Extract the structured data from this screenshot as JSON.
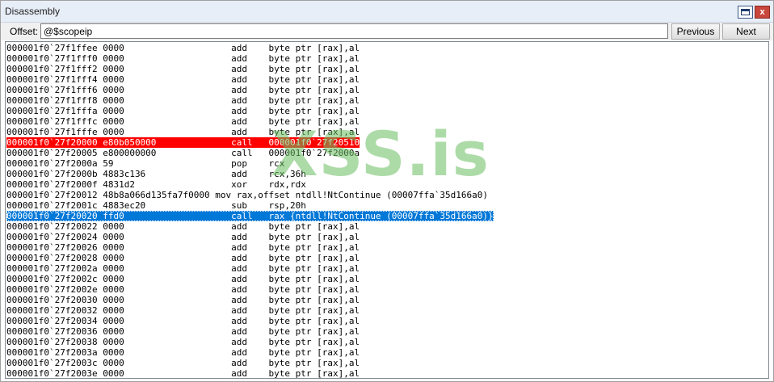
{
  "window": {
    "title": "Disassembly",
    "close_glyph": "x",
    "restore_icon": "window-restore-icon",
    "close_icon": "close-icon"
  },
  "toolbar": {
    "offset_label": "Offset:",
    "offset_value": "@$scopeip",
    "previous_label": "Previous",
    "next_label": "Next"
  },
  "listing": {
    "rows": [
      {
        "addr": "000001f0`27f1ffee",
        "bytes": "0000",
        "mnem": "add",
        "ops": "byte ptr [rax],al"
      },
      {
        "addr": "000001f0`27f1fff0",
        "bytes": "0000",
        "mnem": "add",
        "ops": "byte ptr [rax],al"
      },
      {
        "addr": "000001f0`27f1fff2",
        "bytes": "0000",
        "mnem": "add",
        "ops": "byte ptr [rax],al"
      },
      {
        "addr": "000001f0`27f1fff4",
        "bytes": "0000",
        "mnem": "add",
        "ops": "byte ptr [rax],al"
      },
      {
        "addr": "000001f0`27f1fff6",
        "bytes": "0000",
        "mnem": "add",
        "ops": "byte ptr [rax],al"
      },
      {
        "addr": "000001f0`27f1fff8",
        "bytes": "0000",
        "mnem": "add",
        "ops": "byte ptr [rax],al"
      },
      {
        "addr": "000001f0`27f1fffa",
        "bytes": "0000",
        "mnem": "add",
        "ops": "byte ptr [rax],al"
      },
      {
        "addr": "000001f0`27f1fffc",
        "bytes": "0000",
        "mnem": "add",
        "ops": "byte ptr [rax],al"
      },
      {
        "addr": "000001f0`27f1fffe",
        "bytes": "0000",
        "mnem": "add",
        "ops": "byte ptr [rax],al"
      },
      {
        "addr": "000001f0`27f20000",
        "bytes": "e80b050000",
        "mnem": "call",
        "ops": "000001f0`27f20510",
        "highlight": "red"
      },
      {
        "addr": "000001f0`27f20005",
        "bytes": "e800000000",
        "mnem": "call",
        "ops": "000001f0`27f2000a"
      },
      {
        "addr": "000001f0`27f2000a",
        "bytes": "59",
        "mnem": "pop",
        "ops": "rcx"
      },
      {
        "addr": "000001f0`27f2000b",
        "bytes": "4883c136",
        "mnem": "add",
        "ops": "rcx,36h"
      },
      {
        "addr": "000001f0`27f2000f",
        "bytes": "4831d2",
        "mnem": "xor",
        "ops": "rdx,rdx"
      },
      {
        "addr": "000001f0`27f20012",
        "bytes": "48b8a066d135fa7f0000",
        "mnem": "mov",
        "ops": "rax,offset ntdll!NtContinue (00007ffa`35d166a0)",
        "compact": true
      },
      {
        "addr": "000001f0`27f2001c",
        "bytes": "4883ec20",
        "mnem": "sub",
        "ops": "rsp,20h"
      },
      {
        "addr": "000001f0`27f20020",
        "bytes": "ffd0",
        "mnem": "call",
        "ops": "rax {ntdll!NtContinue (00007ffa`35d166a0)}",
        "highlight": "blue"
      },
      {
        "addr": "000001f0`27f20022",
        "bytes": "0000",
        "mnem": "add",
        "ops": "byte ptr [rax],al"
      },
      {
        "addr": "000001f0`27f20024",
        "bytes": "0000",
        "mnem": "add",
        "ops": "byte ptr [rax],al"
      },
      {
        "addr": "000001f0`27f20026",
        "bytes": "0000",
        "mnem": "add",
        "ops": "byte ptr [rax],al"
      },
      {
        "addr": "000001f0`27f20028",
        "bytes": "0000",
        "mnem": "add",
        "ops": "byte ptr [rax],al"
      },
      {
        "addr": "000001f0`27f2002a",
        "bytes": "0000",
        "mnem": "add",
        "ops": "byte ptr [rax],al"
      },
      {
        "addr": "000001f0`27f2002c",
        "bytes": "0000",
        "mnem": "add",
        "ops": "byte ptr [rax],al"
      },
      {
        "addr": "000001f0`27f2002e",
        "bytes": "0000",
        "mnem": "add",
        "ops": "byte ptr [rax],al"
      },
      {
        "addr": "000001f0`27f20030",
        "bytes": "0000",
        "mnem": "add",
        "ops": "byte ptr [rax],al"
      },
      {
        "addr": "000001f0`27f20032",
        "bytes": "0000",
        "mnem": "add",
        "ops": "byte ptr [rax],al"
      },
      {
        "addr": "000001f0`27f20034",
        "bytes": "0000",
        "mnem": "add",
        "ops": "byte ptr [rax],al"
      },
      {
        "addr": "000001f0`27f20036",
        "bytes": "0000",
        "mnem": "add",
        "ops": "byte ptr [rax],al"
      },
      {
        "addr": "000001f0`27f20038",
        "bytes": "0000",
        "mnem": "add",
        "ops": "byte ptr [rax],al"
      },
      {
        "addr": "000001f0`27f2003a",
        "bytes": "0000",
        "mnem": "add",
        "ops": "byte ptr [rax],al"
      },
      {
        "addr": "000001f0`27f2003c",
        "bytes": "0000",
        "mnem": "add",
        "ops": "byte ptr [rax],al"
      },
      {
        "addr": "000001f0`27f2003e",
        "bytes": "0000",
        "mnem": "add",
        "ops": "byte ptr [rax],al"
      }
    ]
  },
  "watermark": {
    "text": "XSS.is",
    "color": "#6abe60"
  },
  "colors": {
    "highlight_red": "#ff0000",
    "highlight_blue": "#0078d7",
    "close_button": "#c9463d"
  }
}
